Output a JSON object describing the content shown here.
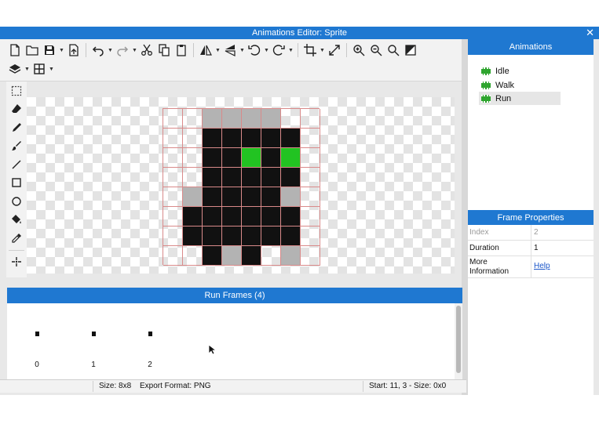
{
  "window": {
    "title": "Animations Editor: Sprite",
    "close_glyph": "✕"
  },
  "toolbar": {
    "row1": [
      "new-file-icon",
      "open-folder-icon",
      "save-icon",
      "export-icon",
      "undo-icon",
      "redo-icon",
      "cut-icon",
      "copy-icon",
      "paste-icon",
      "flip-horizontal-icon",
      "flip-vertical-icon",
      "rotate-left-icon",
      "rotate-right-icon",
      "crop-icon",
      "resize-icon",
      "zoom-in-icon",
      "zoom-out-icon",
      "zoom-fit-icon",
      "invert-icon"
    ],
    "row2": [
      "layers-icon",
      "grid-icon"
    ]
  },
  "tools": [
    "select-rect-icon",
    "eraser-icon",
    "pencil-icon",
    "brush-icon",
    "line-icon",
    "rectangle-icon",
    "ellipse-icon",
    "fill-bucket-icon",
    "eyedropper-icon",
    "magic-wand-icon"
  ],
  "sprite": {
    "width": 8,
    "height": 8,
    "palette": {
      "K": "#111111",
      "G": "#22c322",
      "S": "#b3b3b3",
      ".": "transparent"
    },
    "pixels": [
      "..SSSS..",
      "..KKKKK.",
      "..KKGKG.",
      "..KKKKK.",
      ".SKKKKS.",
      ".KKKKKK.",
      ".KKKKKK.",
      "..KSK.S."
    ]
  },
  "frames_panel": {
    "title": "Run Frames (4)",
    "frames": [
      {
        "index": "0"
      },
      {
        "index": "1"
      },
      {
        "index": "2"
      }
    ]
  },
  "status": {
    "size": "Size: 8x8",
    "export_format": "Export Format: PNG",
    "selection": "Start: 11, 3 - Size: 0x0"
  },
  "animations_panel": {
    "title": "Animations",
    "items": [
      {
        "label": "Idle",
        "selected": false
      },
      {
        "label": "Walk",
        "selected": false
      },
      {
        "label": "Run",
        "selected": true
      }
    ]
  },
  "frame_properties": {
    "title": "Frame Properties",
    "rows": [
      {
        "key": "Index",
        "value": "2"
      },
      {
        "key": "Duration",
        "value": "1"
      },
      {
        "key": "More Information",
        "value": "Help"
      }
    ]
  },
  "colors": {
    "accent": "#1f78d1",
    "sprite_green": "#22c322",
    "link": "#1a55c8"
  }
}
